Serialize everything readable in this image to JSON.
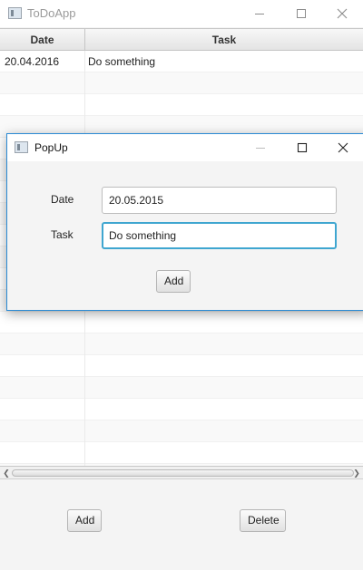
{
  "main_window": {
    "title": "ToDoApp"
  },
  "table": {
    "columns": [
      "Date",
      "Task"
    ],
    "rows": [
      {
        "date": "20.04.2016",
        "task": "Do something"
      },
      {
        "date": "",
        "task": ""
      },
      {
        "date": "",
        "task": ""
      },
      {
        "date": "",
        "task": ""
      },
      {
        "date": "",
        "task": ""
      },
      {
        "date": "",
        "task": ""
      },
      {
        "date": "",
        "task": ""
      },
      {
        "date": "",
        "task": ""
      },
      {
        "date": "",
        "task": ""
      },
      {
        "date": "",
        "task": ""
      },
      {
        "date": "",
        "task": ""
      },
      {
        "date": "",
        "task": ""
      },
      {
        "date": "",
        "task": ""
      },
      {
        "date": "",
        "task": ""
      },
      {
        "date": "",
        "task": ""
      },
      {
        "date": "",
        "task": ""
      },
      {
        "date": "",
        "task": ""
      },
      {
        "date": "",
        "task": ""
      },
      {
        "date": "",
        "task": ""
      },
      {
        "date": "",
        "task": ""
      }
    ]
  },
  "toolbar": {
    "add_label": "Add",
    "delete_label": "Delete"
  },
  "popup": {
    "title": "PopUp",
    "date_label": "Date",
    "date_value": "20.05.2015",
    "task_label": "Task",
    "task_value": "Do something",
    "add_label": "Add"
  },
  "icons": {
    "app": "window-app-icon",
    "minimize": "minimize-icon",
    "maximize": "maximize-icon",
    "close": "close-icon",
    "scroll_left": "chevron-left-icon",
    "scroll_right": "chevron-right-icon"
  }
}
